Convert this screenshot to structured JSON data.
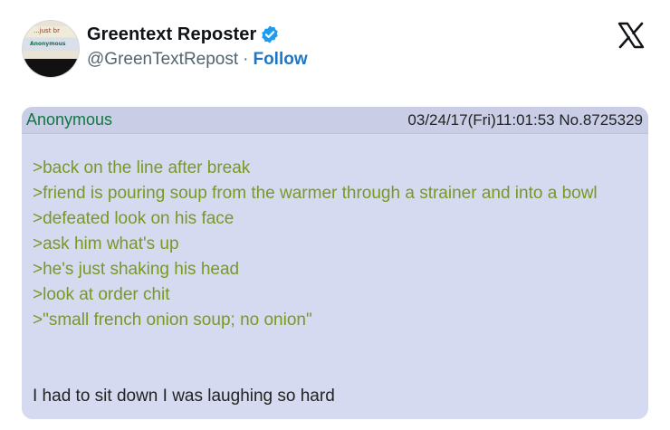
{
  "header": {
    "avatar_top_text": "...just br",
    "avatar_name_text": "Anonymous",
    "display_name": "Greentext Reposter",
    "handle": "@GreenTextRepost",
    "separator": "·",
    "follow_label": "Follow",
    "verified_icon": "verified-badge-icon",
    "platform_icon": "x-logo-icon"
  },
  "post": {
    "author": "Anonymous",
    "meta": "03/24/17(Fri)11:01:53 No.8725329",
    "lines": [
      ">back on the line after break",
      ">friend is pouring soup from the warmer through a strainer and into a bowl",
      ">defeated look on his face",
      ">ask him what's up",
      ">he's just shaking his head",
      ">look at order chit",
      ">\"small french onion soup; no onion\""
    ],
    "closing": "I had to sit down I was laughing so hard"
  },
  "colors": {
    "follow": "#1d77c8",
    "verified": "#1d9bf0",
    "post_bg": "#d6daf0",
    "greentext": "#789922",
    "author": "#117743"
  }
}
